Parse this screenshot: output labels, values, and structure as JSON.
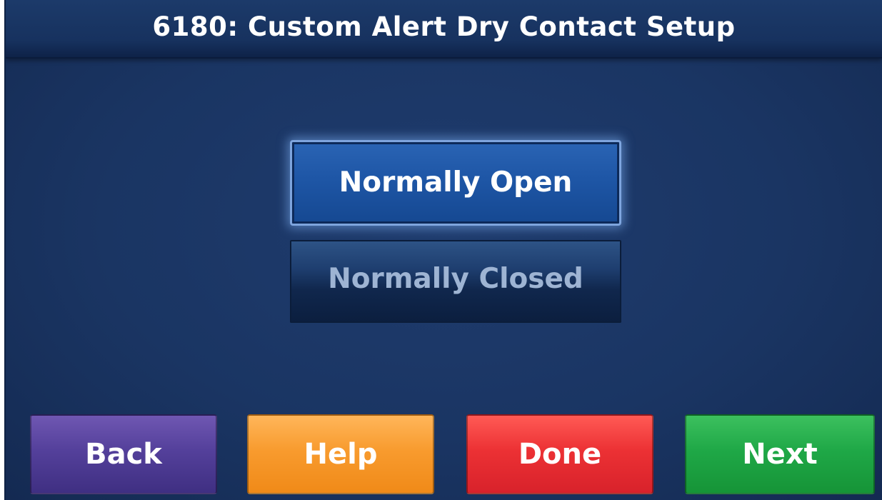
{
  "header": {
    "title": "6180: Custom Alert Dry Contact Setup"
  },
  "options": {
    "normally_open": "Normally Open",
    "normally_closed": "Normally Closed",
    "selected": "Normally Open"
  },
  "nav": {
    "back": "Back",
    "help": "Help",
    "done": "Done",
    "next": "Next"
  },
  "colors": {
    "background": "#1a3563",
    "selected_option": "#1e56a6",
    "back_button": "#54409b",
    "help_button": "#f89b2e",
    "done_button": "#ec3134",
    "next_button": "#1fa847"
  }
}
